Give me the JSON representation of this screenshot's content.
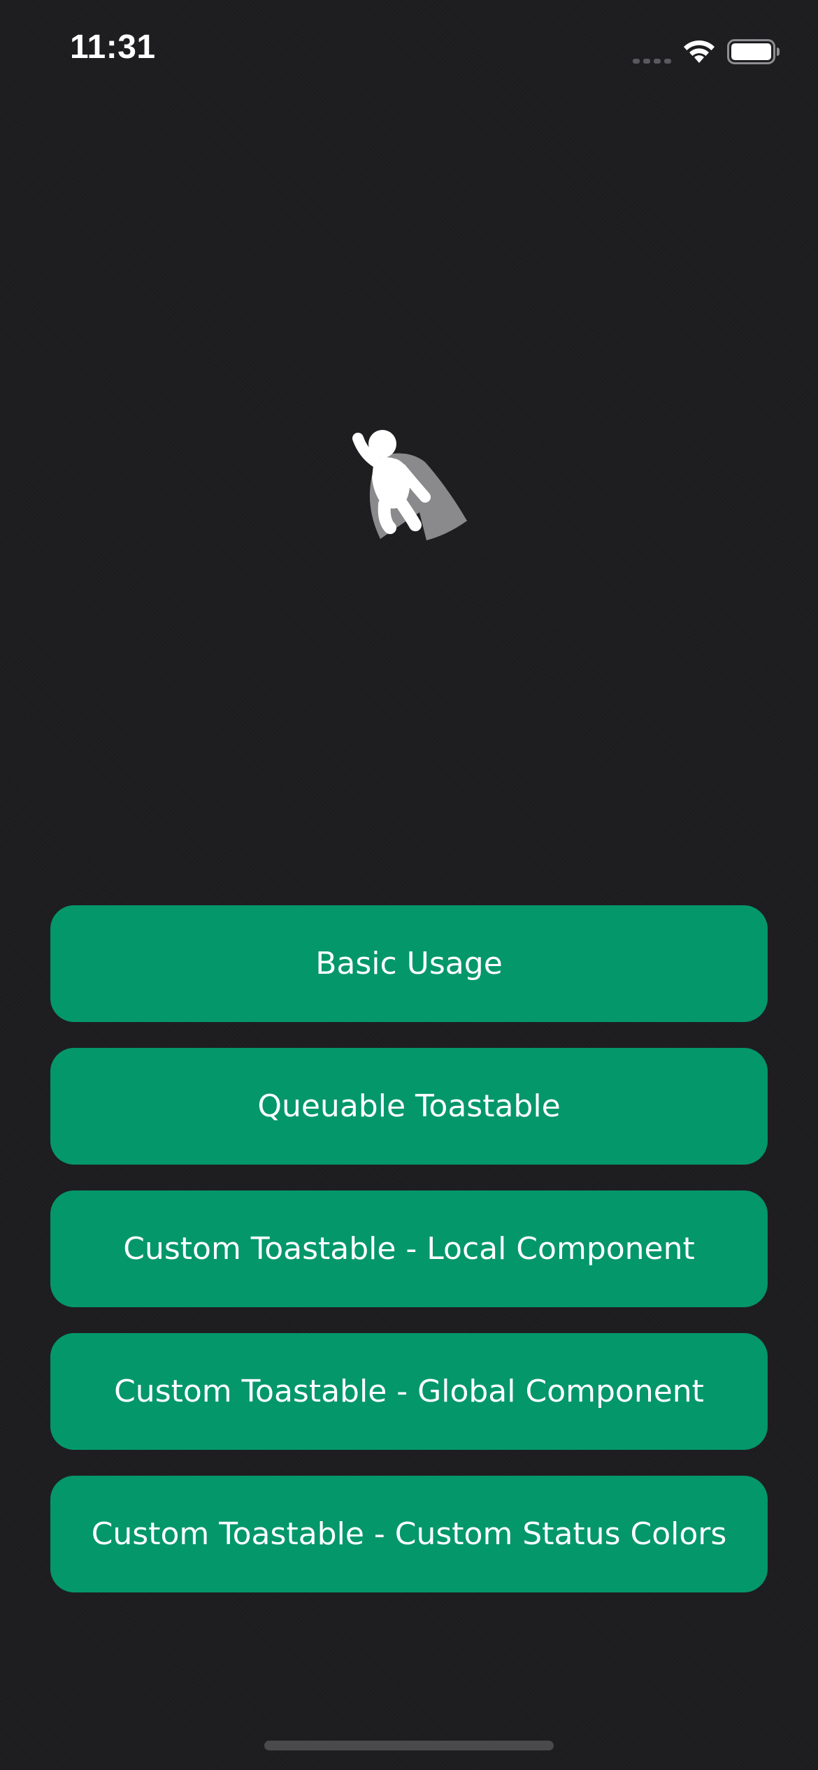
{
  "status_bar": {
    "time": "11:31"
  },
  "hero": {
    "icon": "flying-superhero-icon"
  },
  "buttons": [
    {
      "label": "Basic Usage"
    },
    {
      "label": "Queuable Toastable"
    },
    {
      "label": "Custom Toastable - Local Component"
    },
    {
      "label": "Custom Toastable - Global Component"
    },
    {
      "label": "Custom Toastable - Custom Status Colors"
    }
  ],
  "colors": {
    "background": "#1c1c1e",
    "button": "#04976a",
    "button_text": "#ffffff"
  }
}
